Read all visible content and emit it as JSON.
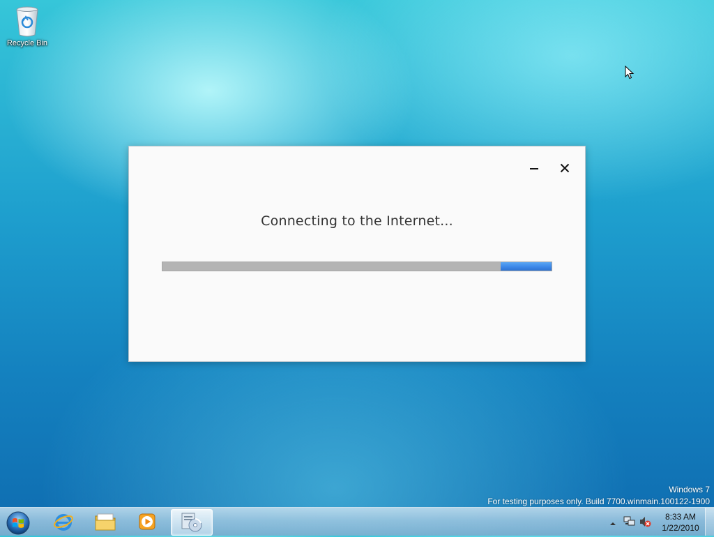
{
  "desktop": {
    "icons": [
      {
        "label": "Recycle Bin",
        "icon": "recycle-bin-icon"
      }
    ]
  },
  "dialog": {
    "message": "Connecting to the Internet...",
    "progress": 0.13,
    "buttons": {
      "minimize": "minimize-icon",
      "close": "close-icon"
    }
  },
  "watermark": {
    "os": "Windows 7",
    "build": "For testing purposes only. Build 7700.winmain.100122-1900"
  },
  "taskbar": {
    "start": "windows-orb-icon",
    "apps": [
      {
        "name": "Internet Explorer",
        "icon": "internet-explorer-icon"
      },
      {
        "name": "Windows Explorer",
        "icon": "folder-icon"
      },
      {
        "name": "Windows Media Player",
        "icon": "media-player-icon"
      },
      {
        "name": "Setup",
        "icon": "setup-disc-icon",
        "active": true
      }
    ],
    "clock": {
      "time": "8:33 AM",
      "date": "1/22/2010"
    }
  },
  "colors": {
    "progress_fill": "#3a85e6",
    "progress_track": "#b4b4b4",
    "dialog_bg": "#fafafa"
  }
}
